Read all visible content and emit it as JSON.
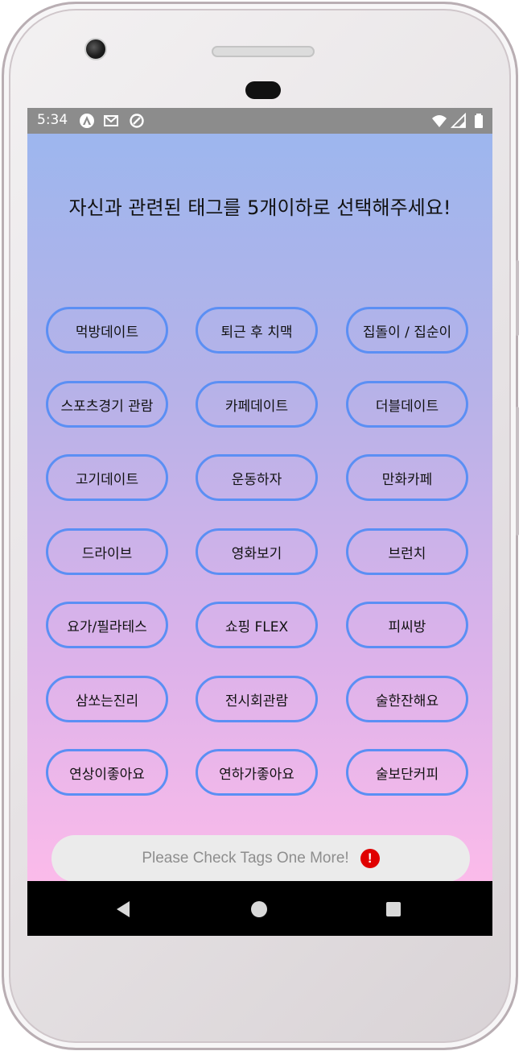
{
  "status_bar": {
    "time": "5:34",
    "left_icons": [
      "android-auto-icon",
      "gmail-icon",
      "sync-icon"
    ],
    "right_icons": [
      "wifi-icon",
      "cellular-icon",
      "battery-icon"
    ]
  },
  "heading": "자신과 관련된 태그를 5개이하로 선택해주세요!",
  "tags": [
    "먹방데이트",
    "퇴근 후 치맥",
    "집돌이 / 집순이",
    "스포츠경기 관람",
    "카페데이트",
    "더블데이트",
    "고기데이트",
    "운동하자",
    "만화카페",
    "드라이브",
    "영화보기",
    "브런치",
    "요가/필라테스",
    "쇼핑 FLEX",
    "피씨방",
    "삼쏘는진리",
    "전시회관람",
    "술한잔해요",
    "연상이좋아요",
    "연하가좋아요",
    "술보단커피"
  ],
  "toast": {
    "message": "Please Check Tags One More!",
    "icon": "error-icon",
    "icon_glyph": "!"
  },
  "nav_bar": {
    "buttons": [
      "back-icon",
      "home-icon",
      "recents-icon"
    ]
  },
  "colors": {
    "tag_border": "#5b8ff4",
    "gradient_top": "#9db6ee",
    "gradient_bottom": "#fbbbea",
    "toast_bg": "#ebebeb",
    "error": "#e00000"
  }
}
